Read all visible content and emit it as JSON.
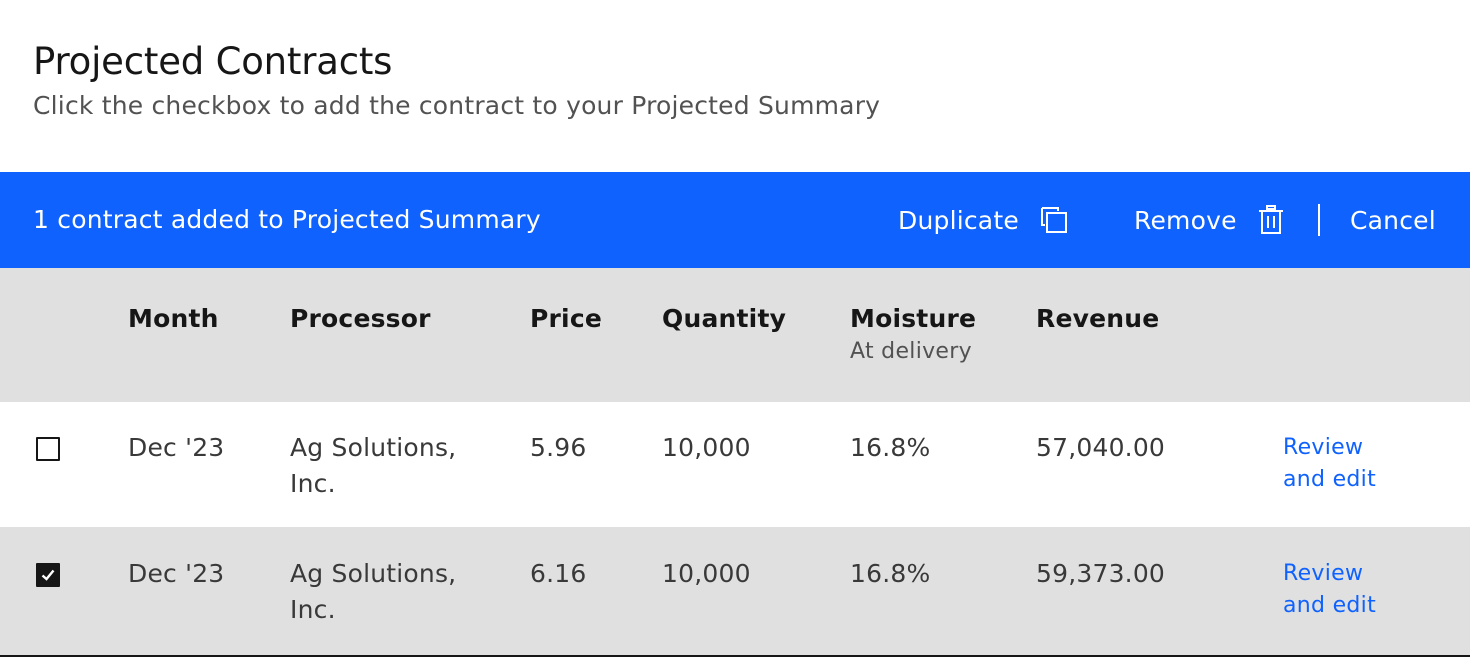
{
  "header": {
    "title": "Projected Contracts",
    "subtitle": "Click the checkbox to add the contract to your Projected Summary"
  },
  "batch_bar": {
    "status": "1 contract added to Projected Summary",
    "duplicate_label": "Duplicate",
    "remove_label": "Remove",
    "cancel_label": "Cancel",
    "background": "#0f62fe"
  },
  "table": {
    "columns": [
      {
        "label": "Month"
      },
      {
        "label": "Processor"
      },
      {
        "label": "Price"
      },
      {
        "label": "Quantity"
      },
      {
        "label": "Moisture",
        "sublabel": "At delivery"
      },
      {
        "label": "Revenue"
      }
    ],
    "rows": [
      {
        "checked": false,
        "month": "Dec '23",
        "processor": "Ag Solutions, Inc.",
        "price": "5.96",
        "quantity": "10,000",
        "moisture": "16.8%",
        "revenue": "57,040.00",
        "action": "Review and edit"
      },
      {
        "checked": true,
        "month": "Dec '23",
        "processor": "Ag Solutions, Inc.",
        "price": "6.16",
        "quantity": "10,000",
        "moisture": "16.8%",
        "revenue": "59,373.00",
        "action": "Review and edit"
      }
    ]
  },
  "icons": {
    "duplicate": "copy-icon",
    "remove": "trash-icon",
    "checkbox_checked": "checkmark-icon"
  },
  "colors": {
    "accent": "#0f62fe",
    "header_bg": "#e0e0e0",
    "text_primary": "#161616",
    "text_secondary": "#525252"
  }
}
